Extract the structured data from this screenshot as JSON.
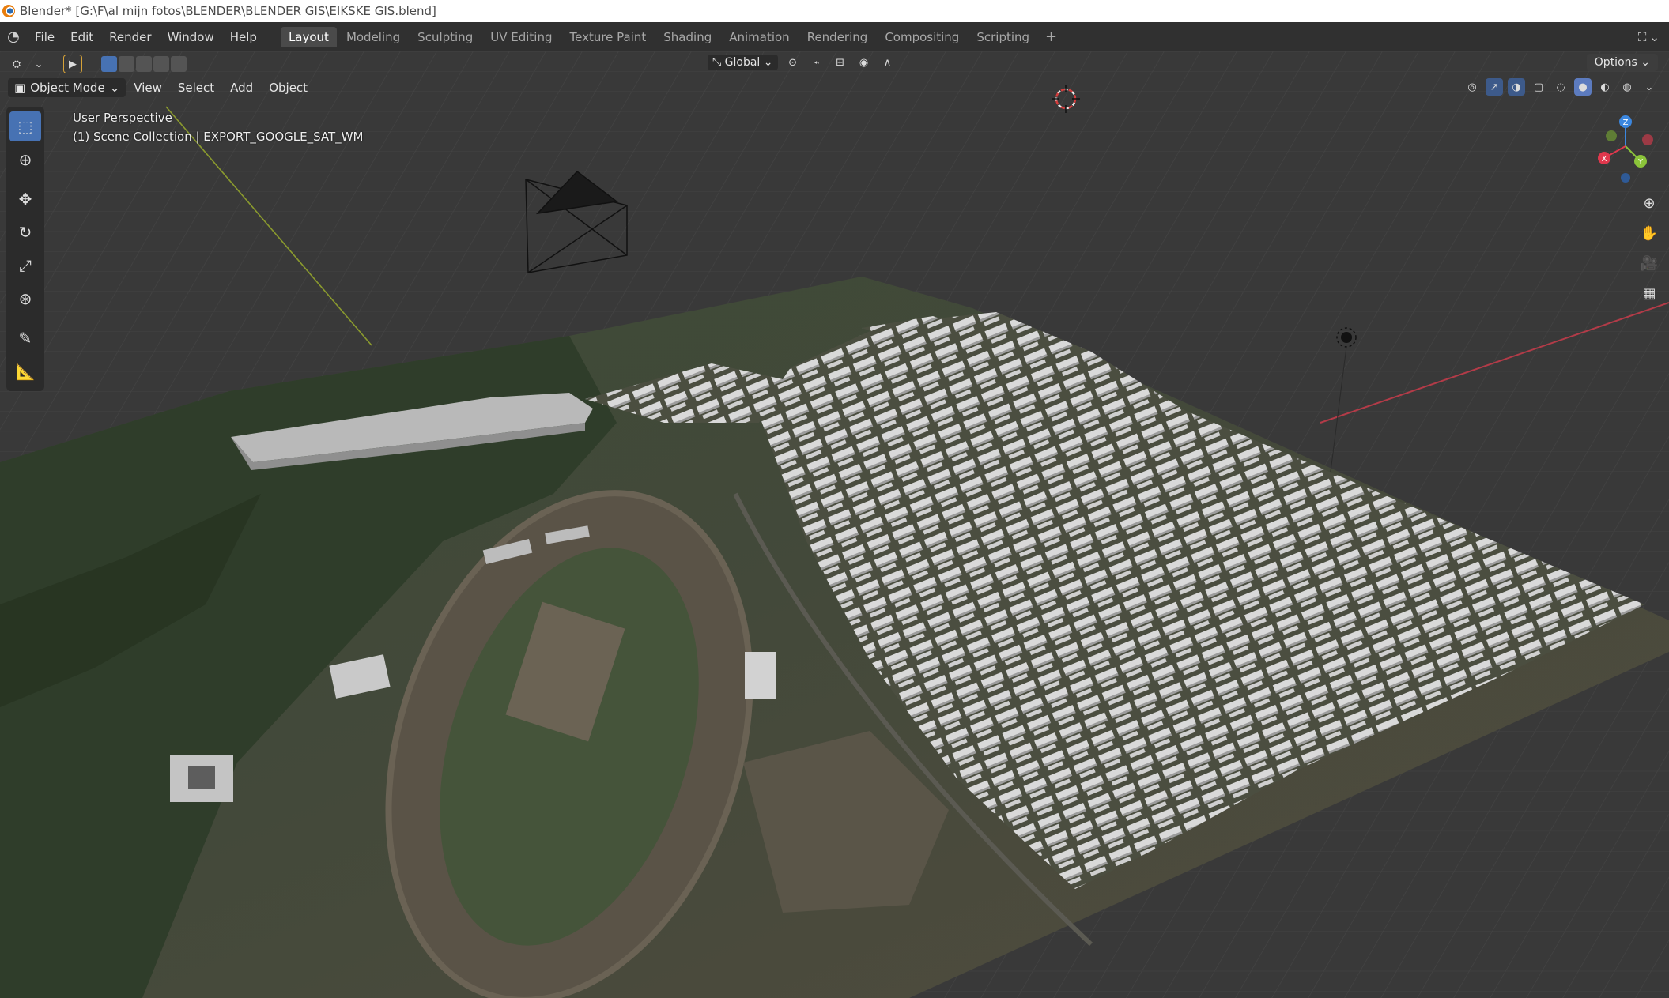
{
  "window": {
    "title": "Blender* [G:\\F\\al mijn fotos\\BLENDER\\BLENDER GIS\\EIKSKE GIS.blend]"
  },
  "menu": {
    "items": [
      "File",
      "Edit",
      "Render",
      "Window",
      "Help"
    ]
  },
  "workspaces": {
    "tabs": [
      "Layout",
      "Modeling",
      "Sculpting",
      "UV Editing",
      "Texture Paint",
      "Shading",
      "Animation",
      "Rendering",
      "Compositing",
      "Scripting"
    ],
    "active": "Layout",
    "add_icon": "+"
  },
  "header": {
    "transform_orientation": "Global",
    "options_label": "Options"
  },
  "viewport_header": {
    "mode": "Object Mode",
    "menus": [
      "View",
      "Select",
      "Add",
      "Object"
    ]
  },
  "overlay": {
    "perspective": "User Perspective",
    "collection": "(1) Scene Collection | EXPORT_GOOGLE_SAT_WM"
  },
  "gizmo": {
    "x": "X",
    "y": "Y",
    "z": "Z"
  },
  "tools": [
    "select-box-icon",
    "cursor-icon",
    "move-icon",
    "rotate-icon",
    "scale-icon",
    "transform-icon",
    "annotate-icon",
    "measure-icon"
  ],
  "colors": {
    "accent": "#4772b3",
    "x_axis": "#e0384d",
    "y_axis": "#8bc43a",
    "z_axis": "#3b87e0"
  }
}
